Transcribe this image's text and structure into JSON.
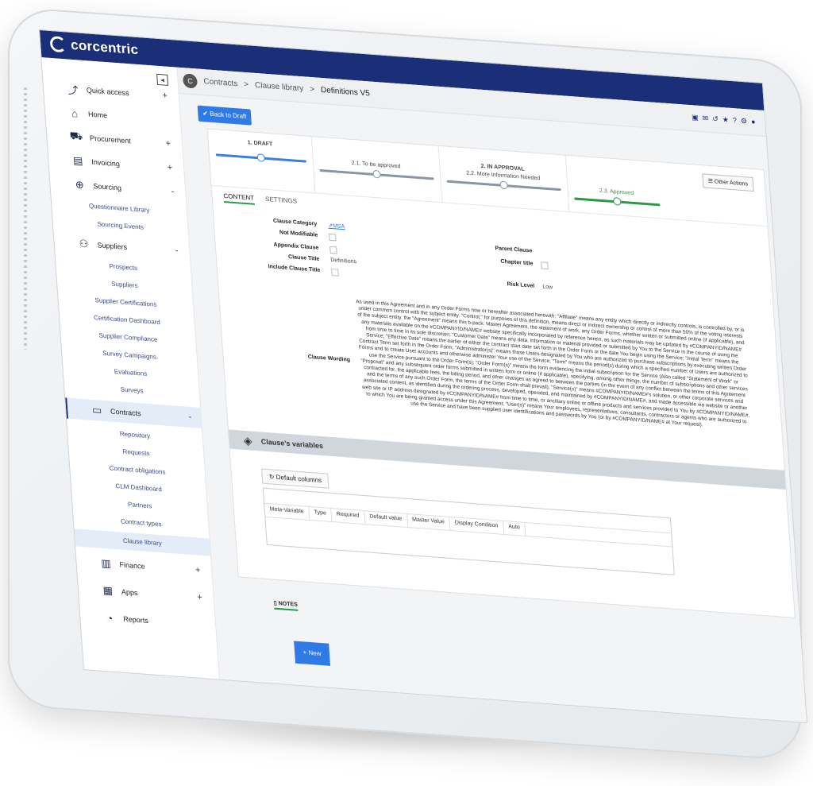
{
  "app": {
    "logo_text": "corcentric"
  },
  "sidebar": {
    "items": [
      {
        "label": "Quick access",
        "toggle": "+"
      },
      {
        "label": "Home"
      },
      {
        "label": "Procurement",
        "toggle": "+"
      },
      {
        "label": "Invoicing",
        "toggle": "+"
      },
      {
        "label": "Sourcing",
        "toggle": "-"
      },
      {
        "label": "Suppliers",
        "toggle": "-"
      },
      {
        "label": "Contracts",
        "toggle": "-"
      },
      {
        "label": "Finance",
        "toggle": "+"
      },
      {
        "label": "Apps",
        "toggle": "+"
      },
      {
        "label": "Reports"
      }
    ],
    "sourcing_sub": [
      "Questionnaire Library",
      "Sourcing Events"
    ],
    "suppliers_sub": [
      "Prospects",
      "Suppliers",
      "Supplier Certifications",
      "Certification Dashboard",
      "Supplier Compliance",
      "Survey Campaigns",
      "Evaluations",
      "Surveys"
    ],
    "contracts_sub": [
      "Repository",
      "Requests",
      "Contract obligations",
      "CLM Dashboard",
      "Partners",
      "Contract types",
      "Clause library"
    ]
  },
  "header": {
    "avatar_letter": "C",
    "breadcrumb": [
      "Contracts",
      "Clause library",
      "Definitions V5"
    ],
    "separator": ">"
  },
  "actions": {
    "back_to_draft": "Back to Draft",
    "other_actions": "Other Actions"
  },
  "stepper": {
    "steps": [
      {
        "title": "1. DRAFT",
        "sub": ""
      },
      {
        "title": "",
        "sub": "2.1. To be approved"
      },
      {
        "title": "2. IN APPROVAL",
        "sub": "2.2. More Information Needed"
      },
      {
        "title": "",
        "sub": "2.3. Approved"
      }
    ],
    "colors": {
      "active": "#3b7fe0",
      "pending": "#8a95a3",
      "approved": "#2b9a47"
    }
  },
  "tabs": [
    "CONTENT",
    "SETTINGS"
  ],
  "form": {
    "clause_category_label": "Clause Category",
    "clause_category_value": "MSA",
    "not_modifiable_label": "Not Modifiable",
    "appendix_clause_label": "Appendix Clause",
    "clause_title_label": "Clause Title",
    "clause_title_value": "Definitions",
    "include_clause_title_label": "Include Clause Title",
    "parent_clause_label": "Parent Clause",
    "chapter_title_label": "Chapter title",
    "risk_level_label": "Risk Level",
    "risk_level_value": "Low",
    "clause_wording_label": "Clause Wording",
    "clause_wording_text": "As used in this Agreement and in any Order Forms now or hereafter associated herewith: \"Affiliate\" means any entity which directly or indirectly controls, is controlled by, or is under common control with the subject entity. \"Control,\" for purposes of this definition, means direct or indirect ownership or control of more than 50% of the voting interests of the subject entity. the \"Agreement\" means this b-pack: Master Agreement, the statement of work, any Order Forms, whether written or submitted online (if applicable), and any materials available on the #COMPANYID/NAME# website specifically incorporated by reference herein, as such materials may be updated by #COMPANYID/NAME# from time to time in its sole discretion; \"Customer Data\" means any data, information or material provided or submitted by You to the Service in the course of using the Service; \"Effective Date\" means the earlier of either the contract start date set forth in the Order Form or the date You begin using the Service; \"Initial Term\" means the Contract Term set forth in the Order Form; \"Administrator(s)\" means those Users designated by You who are authorized to purchase subscriptions by executing written Order Forms and to create User accounts and otherwise administer Your use of the Service; \"Term\" means the period(s) during which a specified number of Users are authorized to use the Service pursuant to the Order Form(s); \"Order Form(s)\" means the form evidencing the initial subscription for the Service (Also called \"Statement of Work\" or \"Proposal\" and any subsequent order forms submitted in written form or online (if applicable), specifying, among other things, the number of subscriptions and other services contracted for, the applicable fees, the billing period, and other changes as agreed to between the parties (in the event of any conflict between the terms of this Agreement and the terms of any such Order Form, the terms of the Order Form shall prevail); \"Service(s)\" means #COMPANYID/NAME#'s solution, or other corporate services and associated content, as identified during the ordering process, developed, operated, and maintained by #COMPANYID/NAME#, and made accessible via website or another web site or IP address designated by #COMPANYID/NAME# from time to time, or ancillary online or offline products and services provided to You by #COMPANYID/NAME#, to which You are being granted access under this Agreement; \"User(s)\" means Your employees, representatives, consultants, contractors or agents who are authorized to use the Service and have been supplied user identifications and passwords by You (or by #COMPANYID/NAME# at Your request)."
  },
  "variables": {
    "title": "Clause's variables",
    "default_columns_label": "Default columns",
    "columns": [
      "Meta-Variable",
      "Type",
      "Required",
      "Default value",
      "Master Value",
      "Display Condition",
      "Auto"
    ]
  },
  "notes": {
    "tab_label": "NOTES",
    "new_label": "New"
  }
}
